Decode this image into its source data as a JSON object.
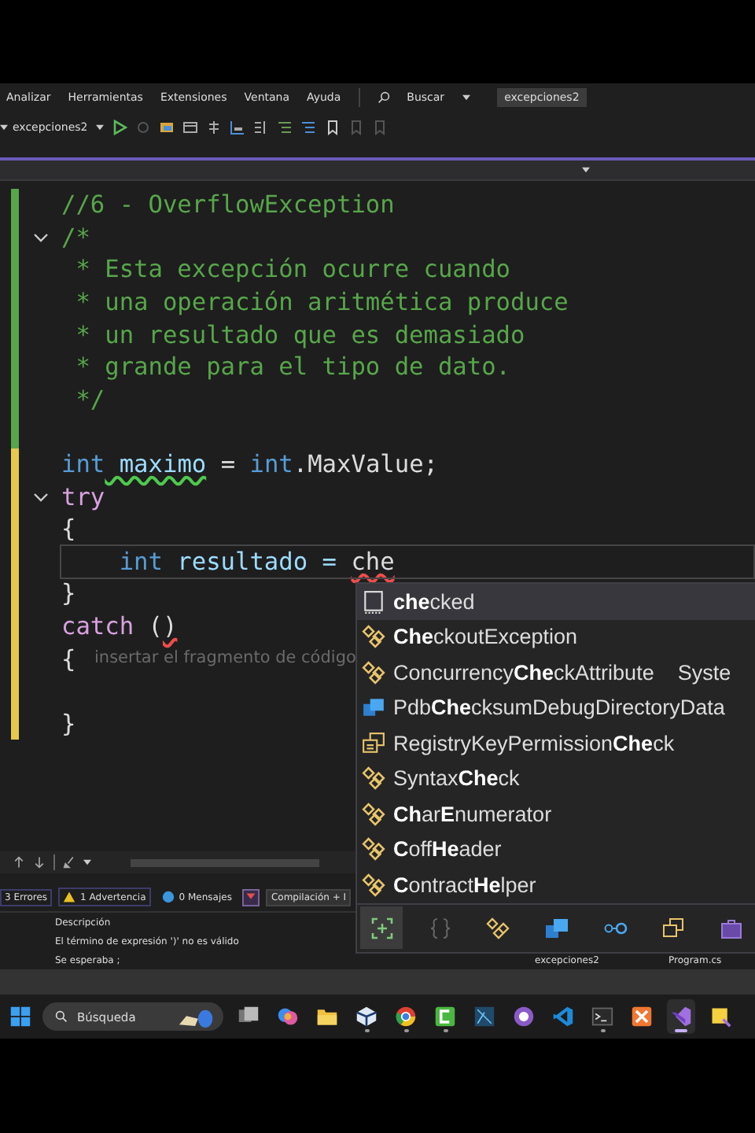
{
  "menu_bar": {
    "items": [
      "Analizar",
      "Herramientas",
      "Extensiones",
      "Ventana",
      "Ayuda"
    ],
    "search": "Buscar",
    "solution": "excepciones2"
  },
  "toolbar": {
    "project": "excepciones2"
  },
  "code_lines": [
    {
      "modified": false,
      "fold": false,
      "current": false,
      "tokens": [
        {
          "text": "//6 - OverflowException",
          "kind": "comment"
        }
      ]
    },
    {
      "modified": false,
      "fold": true,
      "current": false,
      "tokens": [
        {
          "text": "/*",
          "kind": "comment"
        }
      ]
    },
    {
      "modified": false,
      "fold": false,
      "current": false,
      "tokens": [
        {
          "text": " * Esta excepción ocurre cuando",
          "kind": "comment"
        }
      ]
    },
    {
      "modified": false,
      "fold": false,
      "current": false,
      "tokens": [
        {
          "text": " * una operación aritmética produce",
          "kind": "comment"
        }
      ]
    },
    {
      "modified": false,
      "fold": false,
      "current": false,
      "tokens": [
        {
          "text": " * un resultado que es demasiado",
          "kind": "comment"
        }
      ]
    },
    {
      "modified": false,
      "fold": false,
      "current": false,
      "tokens": [
        {
          "text": " * grande para el tipo de dato.",
          "kind": "comment"
        }
      ]
    },
    {
      "modified": false,
      "fold": false,
      "current": false,
      "tokens": [
        {
          "text": " */",
          "kind": "comment"
        }
      ]
    },
    {
      "modified": false,
      "fold": false,
      "current": false
    },
    {
      "modified": true,
      "fold": false,
      "current": false,
      "tokens": [
        {
          "text": "int",
          "kind": "keyword"
        },
        {
          "text": " maximo",
          "kind": "ident",
          "color": "#4ec94e"
        },
        {
          "text": " = ",
          "kind": "plain"
        },
        {
          "text": "int",
          "kind": "keyword"
        },
        {
          "text": ".MaxValue;",
          "kind": "plain"
        }
      ]
    },
    {
      "modified": true,
      "fold": true,
      "current": false,
      "tokens": [
        {
          "text": "try",
          "kind": "control"
        }
      ]
    },
    {
      "modified": true,
      "fold": false,
      "current": false,
      "tokens": [
        {
          "text": "{",
          "kind": "plain"
        }
      ]
    },
    {
      "modified": true,
      "fold": false,
      "current": true,
      "tokens": [
        {
          "text": "    int",
          "kind": "keyword"
        },
        {
          "text": " resultado = ",
          "kind": "ident"
        },
        {
          "text": "che",
          "kind": "plain",
          "color": "#f14c4c"
        }
      ]
    },
    {
      "modified": true,
      "fold": false,
      "current": false,
      "tokens": [
        {
          "text": "}",
          "kind": "plain"
        }
      ]
    },
    {
      "modified": true,
      "fold": false,
      "current": false,
      "tokens": [
        {
          "text": "catch",
          "kind": "control"
        },
        {
          "text": " (",
          "kind": "plain"
        },
        {
          "text": ")",
          "kind": "plain",
          "color": "#f14c4c"
        }
      ]
    },
    {
      "modified": true,
      "fold": false,
      "current": false,
      "tokens": [
        {
          "text": "{",
          "kind": "plain"
        }
      ]
    },
    {
      "modified": true,
      "fold": false,
      "current": false
    },
    {
      "modified": true,
      "fold": false,
      "current": false,
      "tokens": [
        {
          "text": "}",
          "kind": "plain"
        }
      ]
    }
  ],
  "snippet_hint": "insertar el fragmento de código",
  "completion": {
    "items": [
      {
        "kind": "keyword",
        "label": "**che**cked",
        "selected": true
      },
      {
        "kind": "class",
        "label": "**Che**ckoutException",
        "selected": false
      },
      {
        "kind": "class",
        "label": "Concurrency**Che**ckAttribute",
        "detail": "Syste",
        "selected": false
      },
      {
        "kind": "struct",
        "label": "Pdb**Che**cksumDebugDirectoryData",
        "selected": false
      },
      {
        "kind": "enum",
        "label": "RegistryKeyPermission**Che**ck",
        "selected": false
      },
      {
        "kind": "class",
        "label": "Syntax**Che**ck",
        "selected": false
      },
      {
        "kind": "class",
        "label": "**Ch**ar**E**numerator",
        "selected": false
      },
      {
        "kind": "class",
        "label": "**C**off**He**ader",
        "selected": false
      },
      {
        "kind": "class",
        "label": "**C**ontract**He**lper",
        "selected": false
      }
    ],
    "filters": [
      {
        "kind": "snippet",
        "selected": true
      },
      {
        "kind": "namespace",
        "selected": false
      },
      {
        "kind": "class",
        "selected": false
      },
      {
        "kind": "struct",
        "selected": false
      },
      {
        "kind": "interface",
        "selected": false
      },
      {
        "kind": "enum",
        "selected": false
      },
      {
        "kind": "module",
        "selected": false
      }
    ]
  },
  "error_list": {
    "errors": "3 Errores",
    "warnings": "1 Advertencia",
    "messages": "0 Mensajes",
    "scope": "Compilación + I",
    "column": "Descripción",
    "rows": [
      {
        "description": "El término de expresión ')' no es válido"
      },
      {
        "description": "Se esperaba ;",
        "project": "excepciones2",
        "file": "Program.cs"
      }
    ]
  },
  "taskbar": {
    "search": "Búsqueda",
    "apps": [
      {
        "kind": "taskview",
        "running": false,
        "selected": false
      },
      {
        "kind": "swirl",
        "running": false,
        "selected": false
      },
      {
        "kind": "folder",
        "running": false,
        "selected": false
      },
      {
        "kind": "cube",
        "running": true,
        "selected": false
      },
      {
        "kind": "browser",
        "running": true,
        "selected": false
      },
      {
        "kind": "recorder",
        "running": true,
        "selected": false
      },
      {
        "kind": "design",
        "running": false,
        "selected": false
      },
      {
        "kind": "cat",
        "running": false,
        "selected": false
      },
      {
        "kind": "editor",
        "running": false,
        "selected": false
      },
      {
        "kind": "terminal",
        "running": true,
        "selected": false
      },
      {
        "kind": "server",
        "running": false,
        "selected": false
      },
      {
        "kind": "ide",
        "running": true,
        "selected": true
      },
      {
        "kind": "notes",
        "running": false,
        "selected": false
      }
    ]
  }
}
